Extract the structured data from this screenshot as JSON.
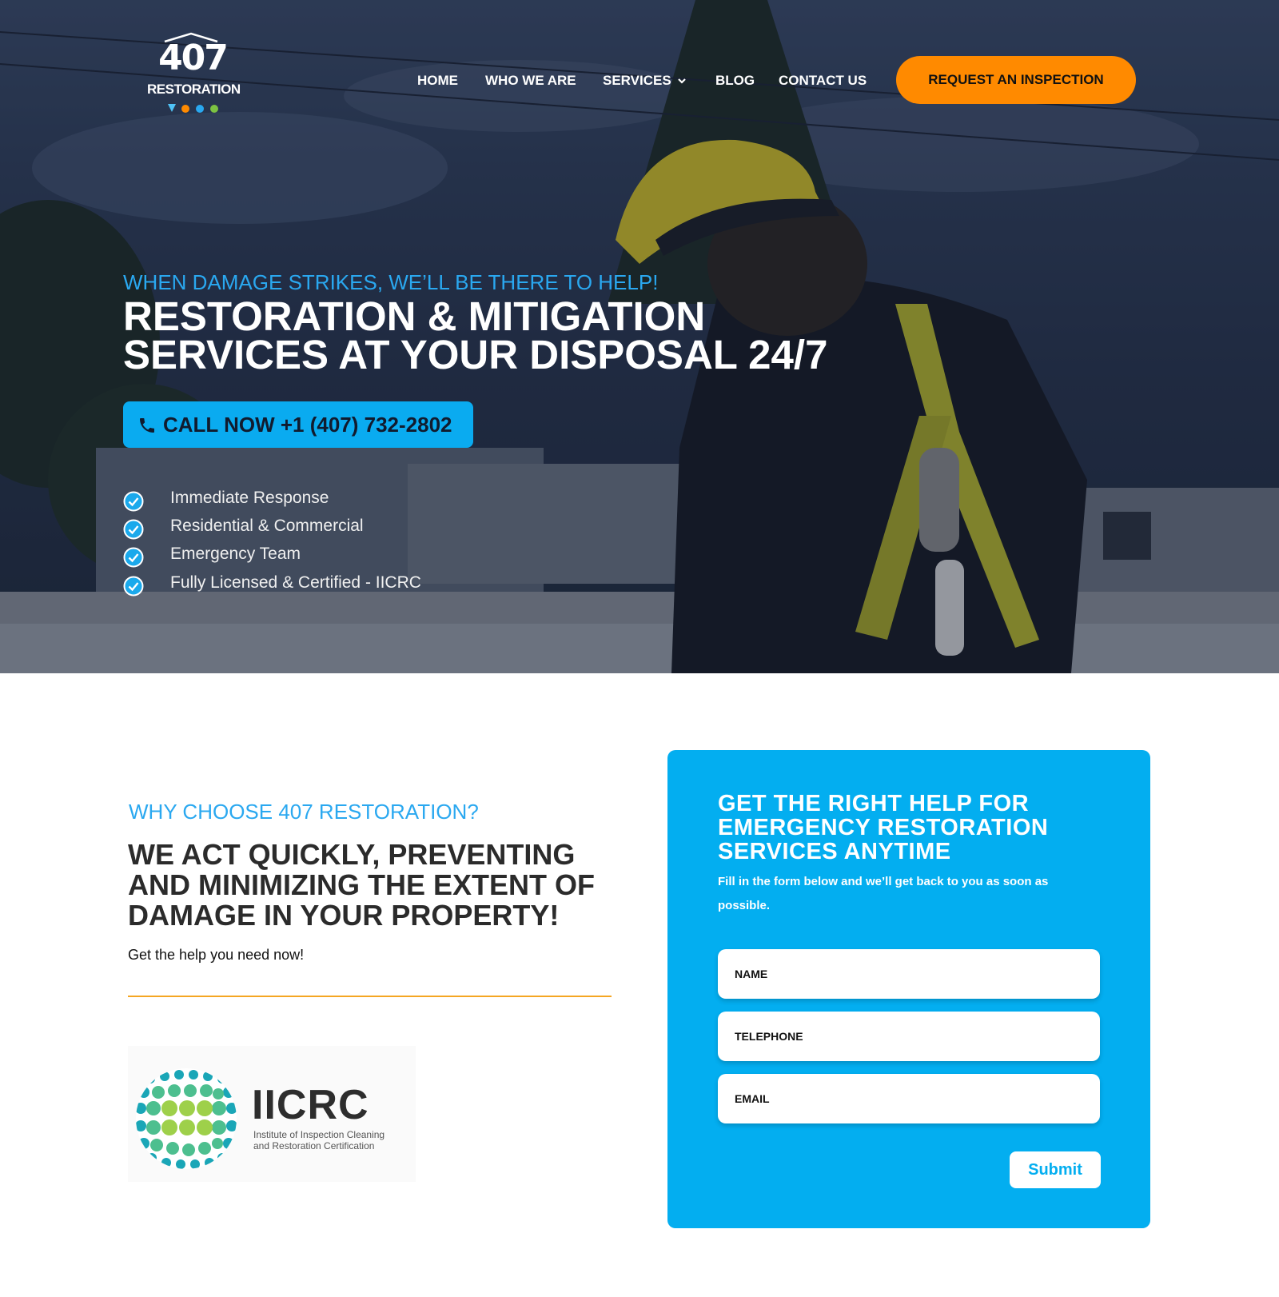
{
  "header": {
    "logo": {
      "number": "407",
      "word": "RESTORATION"
    },
    "nav": [
      {
        "label": "HOME"
      },
      {
        "label": "WHO WE ARE"
      },
      {
        "label": "SERVICES"
      },
      {
        "label": "BLOG"
      },
      {
        "label": "CONTACT US"
      }
    ],
    "cta_label": "REQUEST AN INSPECTION"
  },
  "hero": {
    "kicker": "WHEN DAMAGE STRIKES, WE’LL BE THERE TO HELP!",
    "title_line1": "RESTORATION & MITIGATION",
    "title_line2": "SERVICES AT YOUR DISPOSAL 24/7",
    "call_label": "CALL NOW +1 (407) 732-2802",
    "features": [
      "Immediate Response",
      "Residential & Commercial",
      "Emergency Team",
      "Fully Licensed & Certified - IICRC"
    ]
  },
  "why": {
    "kicker": "WHY CHOOSE 407 RESTORATION?",
    "title": "WE ACT QUICKLY, PREVENTING AND MINIMIZING THE EXTENT OF DAMAGE IN YOUR PROPERTY!",
    "subtitle": "Get the help you need now!"
  },
  "certification": {
    "name": "IICRC",
    "desc_line1": "Institute of Inspection Cleaning",
    "desc_line2": "and Restoration Certification"
  },
  "form": {
    "title": "GET THE RIGHT HELP FOR EMERGENCY RESTORATION SERVICES ANYTIME",
    "subtitle": "Fill in the form below and we’ll get back to you as soon as possible.",
    "fields": {
      "name_placeholder": "NAME",
      "telephone_placeholder": "TELEPHONE",
      "email_placeholder": "EMAIL"
    },
    "submit_label": "Submit"
  },
  "colors": {
    "accent_blue": "#03aef0",
    "accent_orange": "#ff8a00",
    "divider_orange": "#f5a623",
    "heading_dark": "#2b2b2b"
  },
  "icons": {
    "call": "phone-icon",
    "feature": "check-circle-icon",
    "dropdown": "chevron-down-icon"
  }
}
